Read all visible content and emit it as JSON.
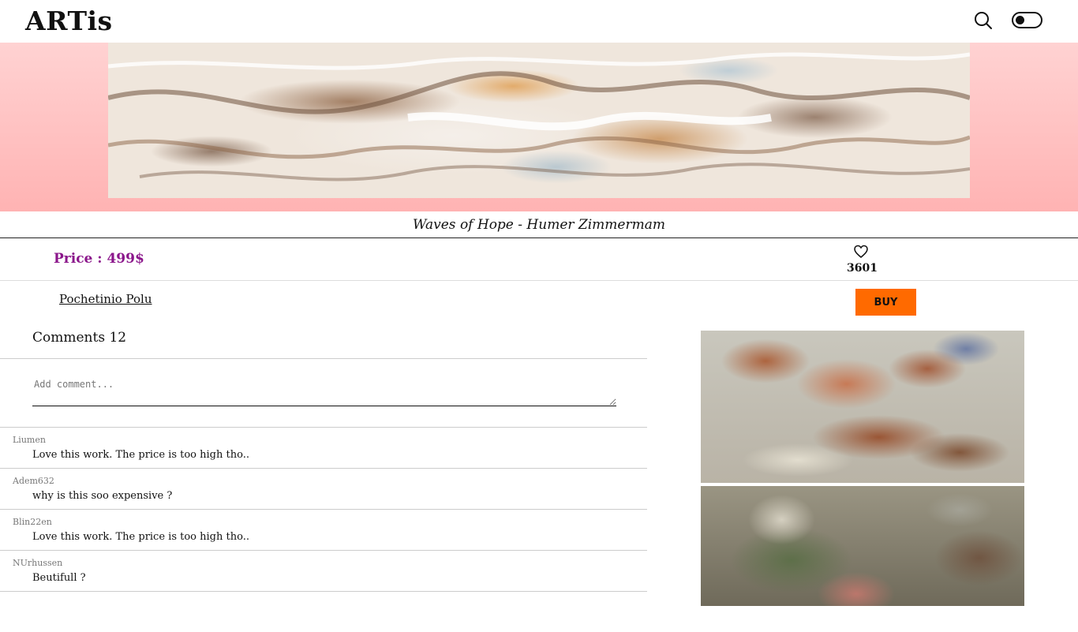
{
  "header": {
    "logo": "ARTis",
    "search_icon": "search-icon",
    "theme_toggle_icon": "theme-toggle"
  },
  "artwork": {
    "title": "Waves of Hope - Humer Zimmermam",
    "price": "Price : 499$",
    "likes": "3601",
    "like_icon": "heart-outline-icon",
    "artist": "Pochetinio Polu",
    "buy_label": "BUY"
  },
  "comments": {
    "heading": "Comments 12",
    "input_placeholder": "Add comment...",
    "items": [
      {
        "user": "Liumen",
        "text": "Love this work. The price is too high tho.."
      },
      {
        "user": "Adem632",
        "text": "why is this soo expensive ?"
      },
      {
        "user": "Blin22en",
        "text": "Love this work. The price is too high tho.."
      },
      {
        "user": "NUrhussen",
        "text": "Beutifull ?"
      }
    ]
  },
  "colors": {
    "price": "#8b168b",
    "buy_button": "#ff6a00",
    "hero_band": "#ffbdbd"
  }
}
